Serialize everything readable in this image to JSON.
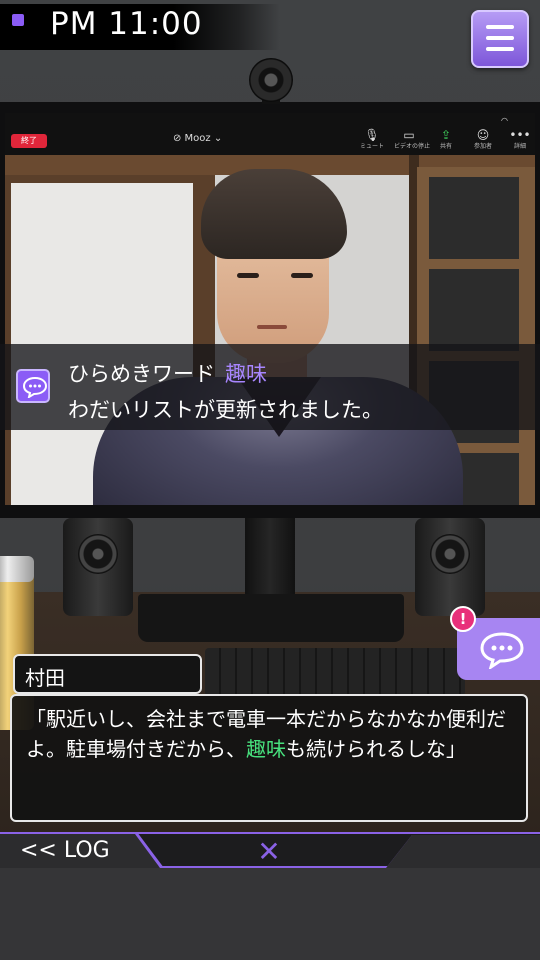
{
  "clock": {
    "time": "PM 11:00"
  },
  "video_call": {
    "end_label": "終了",
    "meeting_title": "⊘ Mooz ⌄",
    "toolbar": [
      {
        "icon": "microphone-icon",
        "label": "ミュート"
      },
      {
        "icon": "video-camera-icon",
        "label": "ビデオの停止"
      },
      {
        "icon": "share-icon",
        "label": "共有"
      },
      {
        "icon": "participants-icon",
        "label": "参加者"
      },
      {
        "icon": "more-icon",
        "label": "詳細"
      }
    ]
  },
  "notification": {
    "prefix": "ひらめきワード",
    "keyword": "趣味",
    "message": "わだいリストが更新されました。",
    "icon": "chat-bubble-icon",
    "accent_color": "#a886ff"
  },
  "chat_button": {
    "icon": "chat-bubble-icon",
    "badge": "!"
  },
  "dialog": {
    "speaker": "村田",
    "text_before": "「駅近いし、会社まで電車一本だからなかなか便利だよ。駐車場付きだから、",
    "highlight": "趣味",
    "text_after": "も続けられるしな」",
    "highlight_color": "#47e07d"
  },
  "bottom_bar": {
    "log_label": "<< LOG",
    "close_icon": "✕"
  },
  "colors": {
    "accent": "#8a62e6",
    "menu": "#a785f2"
  }
}
